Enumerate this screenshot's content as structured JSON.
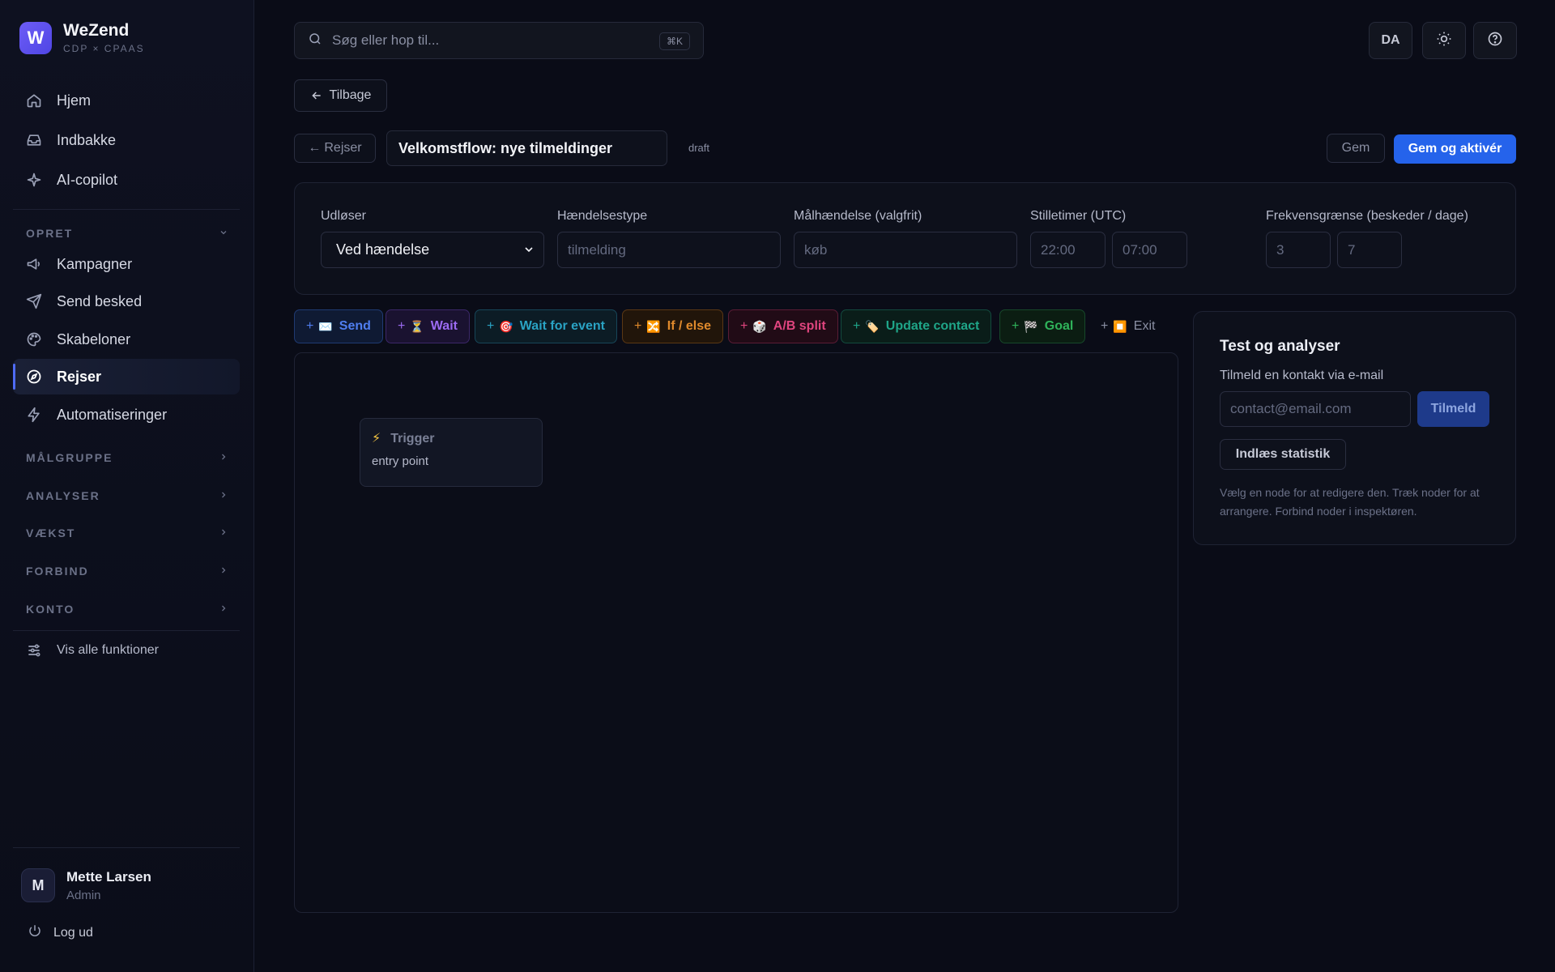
{
  "brand": {
    "logo_letter": "W",
    "name": "WeZend",
    "subtitle": "CDP × CPAAS"
  },
  "nav": {
    "primary": [
      {
        "label": "Hjem",
        "icon": "home-icon"
      },
      {
        "label": "Indbakke",
        "icon": "inbox-icon"
      },
      {
        "label": "AI-copilot",
        "icon": "sparkle-icon"
      }
    ],
    "create_section": "OPRET",
    "create_items": [
      {
        "label": "Kampagner",
        "icon": "megaphone-icon"
      },
      {
        "label": "Send besked",
        "icon": "send-icon"
      },
      {
        "label": "Skabeloner",
        "icon": "palette-icon"
      },
      {
        "label": "Rejser",
        "icon": "compass-icon",
        "active": true
      },
      {
        "label": "Automatiseringer",
        "icon": "bolt-icon"
      }
    ],
    "sections": [
      "MÅLGRUPPE",
      "ANALYSER",
      "VÆKST",
      "FORBIND",
      "KONTO"
    ],
    "all_features": "Vis alle funktioner"
  },
  "user": {
    "initial": "M",
    "name": "Mette Larsen",
    "role": "Admin",
    "logout": "Log ud"
  },
  "topbar": {
    "search_placeholder": "Søg eller hop til...",
    "shortcut": "⌘K",
    "language": "DA"
  },
  "back_button": "Tilbage",
  "journey": {
    "back_label": "Rejser",
    "name": "Velkomstflow: nye tilmeldinger",
    "status": "draft",
    "save": "Gem",
    "save_activate": "Gem og aktivér"
  },
  "settings": {
    "trigger_label": "Udløser",
    "trigger_value": "Ved hændelse",
    "event_type_label": "Hændelsestype",
    "event_type_placeholder": "tilmelding",
    "goal_label": "Målhændelse (valgfrit)",
    "goal_placeholder": "køb",
    "quiet_label": "Stilletimer (UTC)",
    "quiet_from": "22:00",
    "quiet_to": "07:00",
    "freq_label": "Frekvensgrænse (beskeder / dage)",
    "freq_messages": "3",
    "freq_days": "7"
  },
  "palette": [
    {
      "label": "Send",
      "emoji": "✉️",
      "color": "#4f7ef0"
    },
    {
      "label": "Wait",
      "emoji": "⏳",
      "color": "#9b6bf2"
    },
    {
      "label": "Wait for event",
      "emoji": "🎯",
      "color": "#2aa3c4"
    },
    {
      "label": "If / else",
      "emoji": "🔀",
      "color": "#e08a2c"
    },
    {
      "label": "A/B split",
      "emoji": "🎲",
      "color": "#e0457f"
    },
    {
      "label": "Update contact",
      "emoji": "🏷️",
      "color": "#1fa588"
    },
    {
      "label": "Goal",
      "emoji": "🏁",
      "color": "#2fb35a"
    },
    {
      "label": "Exit",
      "emoji": "⏹️",
      "color": "#8a8fa3"
    }
  ],
  "canvas": {
    "node_title": "Trigger",
    "node_sub": "entry point"
  },
  "panel": {
    "title": "Test og analyser",
    "enroll_label": "Tilmeld en kontakt via e-mail",
    "email_placeholder": "contact@email.com",
    "enroll_button": "Tilmeld",
    "stats_button": "Indlæs statistik",
    "hint": "Vælg en node for at redigere den. Træk noder for at arrangere. Forbind noder i inspektøren."
  }
}
